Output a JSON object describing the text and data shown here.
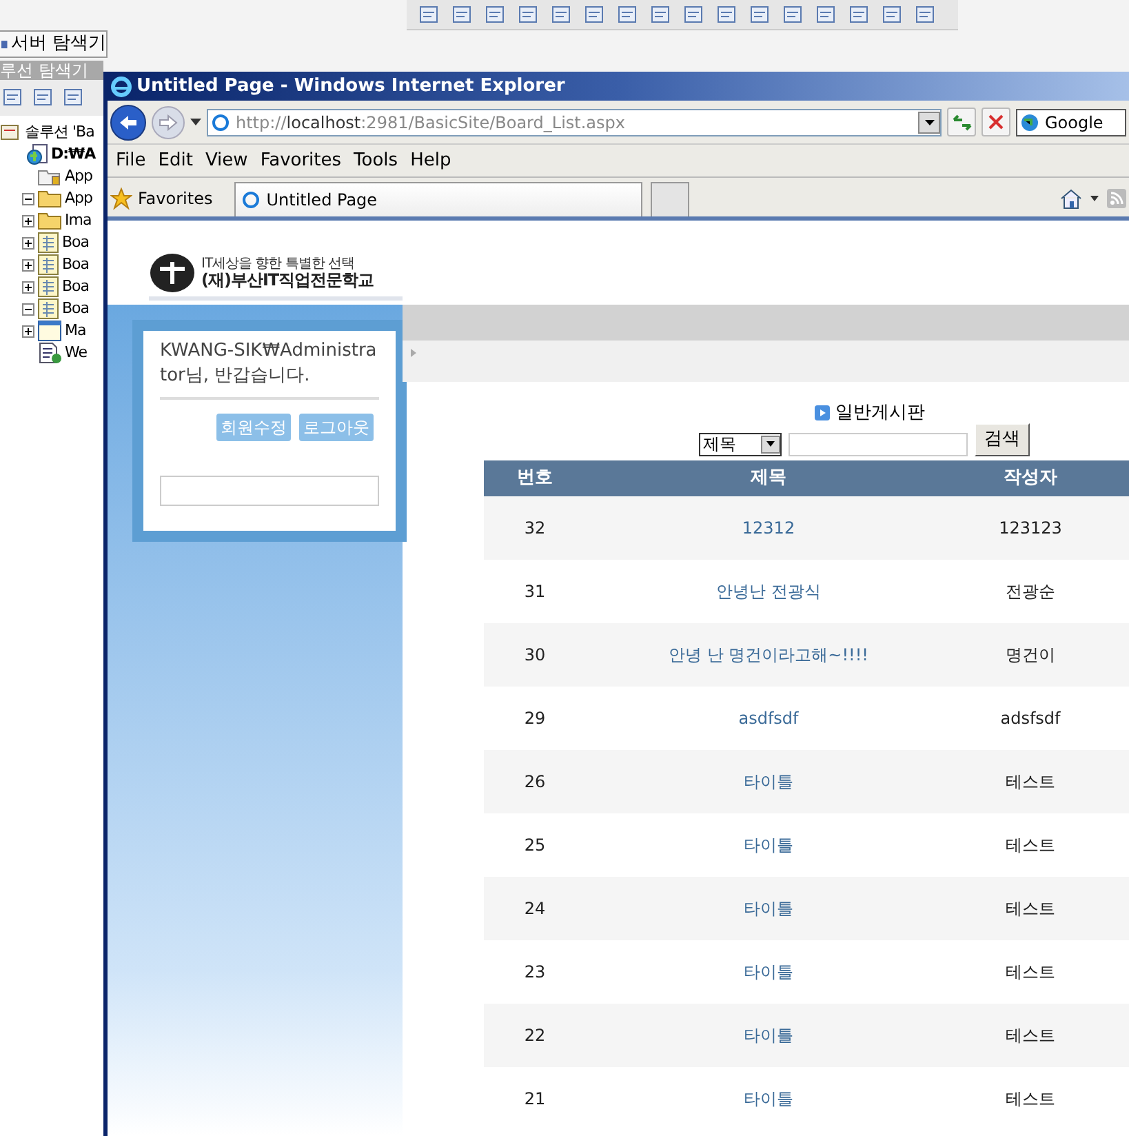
{
  "ide": {
    "server_tab": "서버 탐색기",
    "solution_header": "루선 탐색기",
    "tree": [
      {
        "label": "솔루션 'Ba",
        "kind": "solution",
        "children": [
          {
            "label": "D:₩A",
            "kind": "website",
            "children": [
              {
                "label": "App",
                "kind": "folder-locked"
              },
              {
                "label": "App",
                "kind": "folder",
                "expanded": true
              },
              {
                "label": "Ima",
                "kind": "folder",
                "expanded": false
              },
              {
                "label": "Boa",
                "kind": "form",
                "expanded": false
              },
              {
                "label": "Boa",
                "kind": "form",
                "expanded": false
              },
              {
                "label": "Boa",
                "kind": "form",
                "expanded": false
              },
              {
                "label": "Boa",
                "kind": "form",
                "expanded": true
              },
              {
                "label": "Ma",
                "kind": "master",
                "expanded": false
              },
              {
                "label": "We",
                "kind": "config"
              }
            ]
          }
        ]
      }
    ]
  },
  "browser": {
    "title": "Untitled Page - Windows Internet Explorer",
    "address": {
      "scheme": "http://",
      "host": "localhost",
      "rest": ":2981/BasicSite/Board_List.aspx"
    },
    "search_provider": "Google",
    "menu": [
      "File",
      "Edit",
      "View",
      "Favorites",
      "Tools",
      "Help"
    ],
    "favorites_label": "Favorites",
    "tabs": [
      {
        "label": "Untitled Page",
        "selected": true
      }
    ]
  },
  "page": {
    "logo": {
      "tagline": "IT세상을 향한 특별한 선택",
      "name": "(재)부산IT직업전문학교"
    },
    "login": {
      "greeting": "KWANG-SIK₩Administrator님, 반갑습니다.",
      "buttons": [
        "회원수정",
        "로그아웃"
      ]
    },
    "board_title": "일반게시판",
    "search": {
      "field": "제목",
      "button": "검색"
    },
    "table": {
      "columns": [
        "번호",
        "제목",
        "작성자"
      ],
      "rows": [
        [
          "32",
          "12312",
          "123123"
        ],
        [
          "31",
          "안녕난 전광식",
          "전광순"
        ],
        [
          "30",
          "안녕 난 명건이라고해~!!!!",
          "명건이"
        ],
        [
          "29",
          "asdfsdf",
          "adsfsdf"
        ],
        [
          "26",
          "타이틀",
          "테스트"
        ],
        [
          "25",
          "타이틀",
          "테스트"
        ],
        [
          "24",
          "타이틀",
          "테스트"
        ],
        [
          "23",
          "타이틀",
          "테스트"
        ],
        [
          "22",
          "타이틀",
          "테스트"
        ],
        [
          "21",
          "타이틀",
          "테스트"
        ]
      ]
    }
  }
}
